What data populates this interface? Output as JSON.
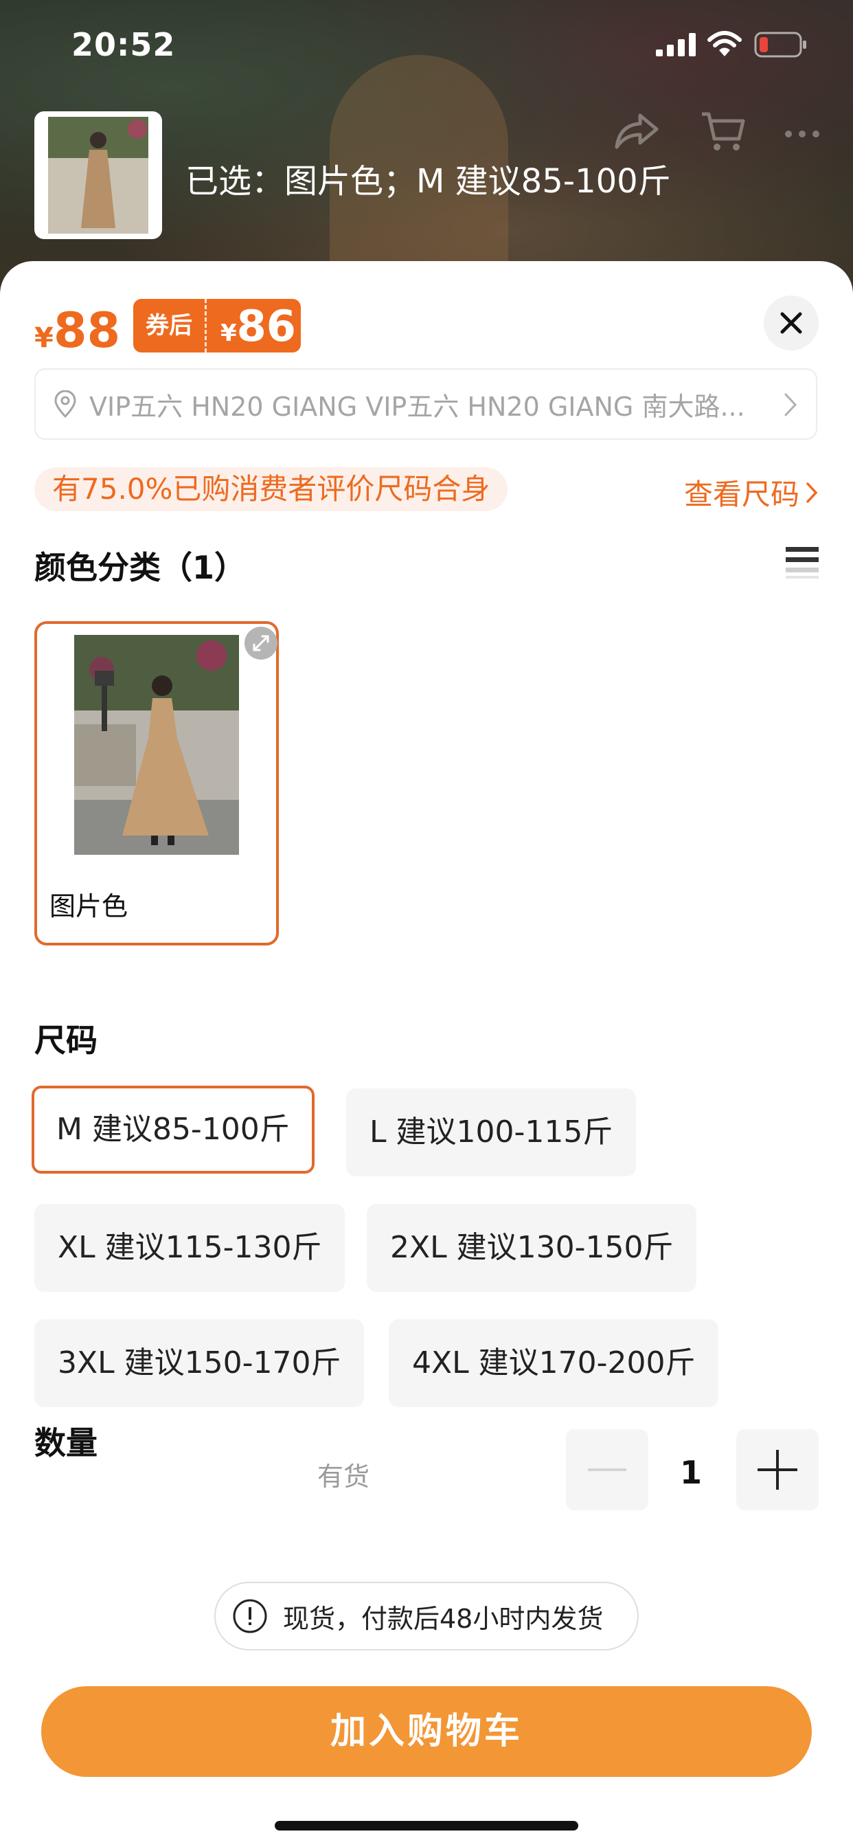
{
  "status_bar": {
    "time": "20:52"
  },
  "header": {
    "selected_text": "已选：图片色；M 建议85-100斤"
  },
  "price": {
    "currency": "¥",
    "original": "88",
    "coupon_label": "券后",
    "coupon_price": "86"
  },
  "address": {
    "text": "VIP五六 HN20 GIANG VIP五六 HN20 GIANG 南大路..."
  },
  "fit": {
    "badge": "有75.0%已购消费者评价尺码合身",
    "size_guide_link": "查看尺码"
  },
  "color_section": {
    "title": "颜色分类（1）",
    "options": [
      {
        "label": "图片色",
        "selected": true
      }
    ]
  },
  "size_section": {
    "title": "尺码",
    "options": [
      {
        "label": "M 建议85-100斤",
        "selected": true
      },
      {
        "label": "L 建议100-115斤",
        "selected": false
      },
      {
        "label": "XL 建议115-130斤",
        "selected": false
      },
      {
        "label": "2XL 建议130-150斤",
        "selected": false
      },
      {
        "label": "3XL 建议150-170斤",
        "selected": false
      },
      {
        "label": "4XL 建议170-200斤",
        "selected": false
      }
    ]
  },
  "quantity": {
    "label": "数量",
    "stock": "有货",
    "value": "1"
  },
  "shipping_note": "现货，付款后48小时内发货",
  "add_to_cart": "加入购物车",
  "colors": {
    "accent": "#ee6a1f",
    "cart_button": "#f39636",
    "selected_border": "#e06a2c"
  }
}
